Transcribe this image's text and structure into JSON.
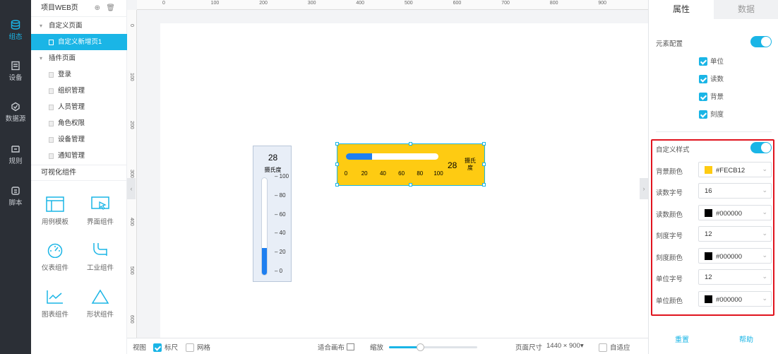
{
  "rail": {
    "items": [
      {
        "label": "组态",
        "icon": "database-icon",
        "active": true
      },
      {
        "label": "设备",
        "icon": "device-icon"
      },
      {
        "label": "数据源",
        "icon": "datasource-icon"
      },
      {
        "label": "规则",
        "icon": "rule-icon"
      },
      {
        "label": "脚本",
        "icon": "script-icon"
      }
    ]
  },
  "tree": {
    "title": "项目WEB页",
    "custom_group": "自定义页面",
    "custom_page": "自定义新增页1",
    "plugin_group": "插件页面",
    "plugin_pages": [
      "登录",
      "组织管理",
      "人员管理",
      "角色权限",
      "设备管理",
      "通知管理"
    ]
  },
  "components": {
    "title": "可视化组件",
    "items": [
      {
        "label": "用例模板",
        "icon": "template-icon"
      },
      {
        "label": "界面组件",
        "icon": "ui-component-icon"
      },
      {
        "label": "仪表组件",
        "icon": "gauge-icon"
      },
      {
        "label": "工业组件",
        "icon": "pipe-icon"
      },
      {
        "label": "图表组件",
        "icon": "chart-icon"
      },
      {
        "label": "形状组件",
        "icon": "triangle-icon"
      }
    ]
  },
  "ruler": {
    "top": [
      "0",
      "100",
      "200",
      "300",
      "400",
      "500",
      "600",
      "700",
      "800",
      "900"
    ],
    "left": [
      "0",
      "100",
      "200",
      "300",
      "400",
      "500",
      "600"
    ]
  },
  "thermometer": {
    "value": "28",
    "unit": "摄氏度",
    "fill_percent": 28,
    "ticks": [
      "100",
      "80",
      "60",
      "40",
      "20",
      "0"
    ]
  },
  "hgauge": {
    "value": "28",
    "unit": "摄氏度",
    "fill_percent": 28,
    "ticks": [
      "0",
      "20",
      "40",
      "60",
      "80",
      "100"
    ],
    "background": "#FECB12"
  },
  "bottom": {
    "view": "视图",
    "ruler": "标尺",
    "grid": "网格",
    "fit": "适合画布",
    "zoom": "缩放",
    "zoom_level": 0.35,
    "page_size_label": "页面尺寸",
    "page_size": "1440 × 900",
    "adaptive": "自适应"
  },
  "panel": {
    "tab_props": "属性",
    "tab_data": "数据",
    "element_config": "元素配置",
    "checks": [
      "单位",
      "读数",
      "背景",
      "刻度"
    ],
    "custom_style": "自定义样式",
    "fields": [
      {
        "label": "背景颜色",
        "value": "#FECB12",
        "swatch": "#fecb12"
      },
      {
        "label": "读数字号",
        "value": "16"
      },
      {
        "label": "读数颜色",
        "value": "#000000",
        "swatch": "#000000"
      },
      {
        "label": "刻度字号",
        "value": "12"
      },
      {
        "label": "刻度颜色",
        "value": "#000000",
        "swatch": "#000000"
      },
      {
        "label": "单位字号",
        "value": "12"
      },
      {
        "label": "单位颜色",
        "value": "#000000",
        "swatch": "#000000"
      }
    ],
    "reset": "重置",
    "help": "帮助"
  }
}
